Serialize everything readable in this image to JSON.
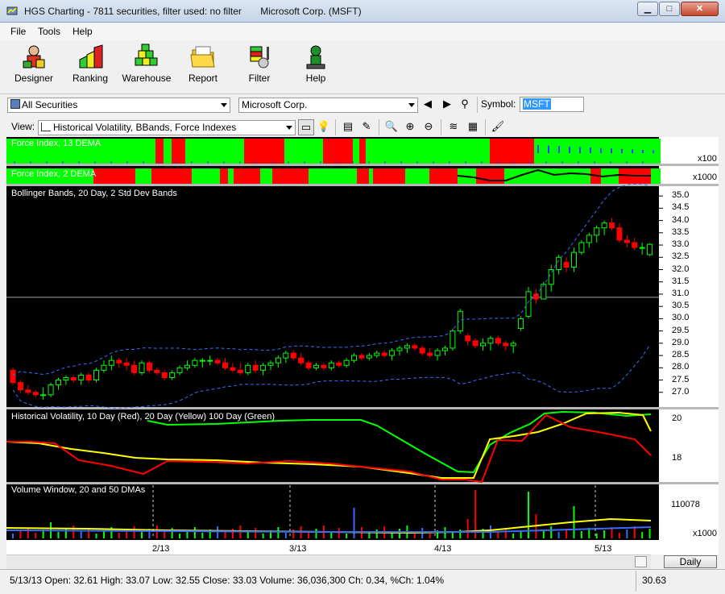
{
  "window": {
    "title": "HGS Charting - 7811 securities, filter used: no filter       Microsoft Corp. (MSFT)",
    "minimize": "▁",
    "maximize": "□",
    "close": "✕"
  },
  "menu": [
    "File",
    "Tools",
    "Help"
  ],
  "toolbar": [
    {
      "label": "Designer",
      "icon": "designer-icon"
    },
    {
      "label": "Ranking",
      "icon": "ranking-icon"
    },
    {
      "label": "Warehouse",
      "icon": "warehouse-icon"
    },
    {
      "label": "Report",
      "icon": "report-icon"
    },
    {
      "label": "Filter",
      "icon": "filter-icon"
    },
    {
      "label": "Help",
      "icon": "help-icon"
    }
  ],
  "securities_list": {
    "value": "All Securities"
  },
  "security": {
    "value": "Microsoft Corp."
  },
  "symbol": {
    "label": "Symbol:",
    "value": "MSFT"
  },
  "view": {
    "label": "View:",
    "value": "Historical Volatility, BBands, Force Indexes"
  },
  "panes": {
    "force13": {
      "label": "Force Index, 13 DEMA",
      "scale": "x100"
    },
    "force2": {
      "label": "Force Index, 2 DEMA",
      "scale": "x1000"
    },
    "bbands": {
      "label": "Bollinger Bands, 20 Day, 2 Std Dev Bands",
      "ticks": [
        "35.0",
        "34.5",
        "34.0",
        "33.5",
        "33.0",
        "32.5",
        "32.0",
        "31.5",
        "31.0",
        "30.5",
        "30.0",
        "29.5",
        "29.0",
        "28.5",
        "28.0",
        "27.5",
        "27.0"
      ]
    },
    "hv": {
      "label": "Historical Volatility, 10 Day (Red), 20 Day (Yellow)  100 Day (Green)",
      "ticks": [
        "20",
        "18"
      ]
    },
    "volume": {
      "label": "Volume Window, 20 and 50 DMAs",
      "ticks": [
        "110078",
        "x1000"
      ]
    }
  },
  "date_labels": [
    "2/13",
    "3/13",
    "4/13",
    "5/13"
  ],
  "period_button": "Daily",
  "status": {
    "text": "5/13/13 Open: 32.61 High: 33.07 Low: 32.55 Close: 33.03 Volume: 36,036,300 Ch: 0.34, %Ch: 1.04%",
    "cursor_value": "30.63"
  },
  "colors": {
    "up": "#00ff00",
    "down": "#ff0000",
    "band": "#3a6bff",
    "yellow": "#ffff00",
    "bg": "#000000"
  },
  "chart_data": [
    {
      "type": "candlestick",
      "title": "Bollinger Bands, 20 Day, 2 Std Dev Bands",
      "ylim": [
        26.5,
        35.3
      ],
      "ohlc": [
        [
          27.9,
          28.0,
          27.3,
          27.4
        ],
        [
          27.4,
          27.5,
          27.0,
          27.1
        ],
        [
          27.1,
          27.3,
          26.9,
          27.0
        ],
        [
          27.0,
          27.1,
          26.8,
          26.9
        ],
        [
          26.9,
          27.2,
          26.7,
          26.9
        ],
        [
          26.9,
          27.4,
          26.8,
          27.3
        ],
        [
          27.3,
          27.6,
          27.1,
          27.5
        ],
        [
          27.5,
          27.7,
          27.3,
          27.6
        ],
        [
          27.6,
          27.7,
          27.4,
          27.5
        ],
        [
          27.5,
          27.8,
          27.3,
          27.7
        ],
        [
          27.7,
          27.8,
          27.4,
          27.5
        ],
        [
          27.5,
          28.0,
          27.4,
          27.9
        ],
        [
          27.9,
          28.3,
          27.8,
          28.1
        ],
        [
          28.1,
          28.5,
          27.9,
          28.3
        ],
        [
          28.3,
          28.4,
          28.0,
          28.2
        ],
        [
          28.2,
          28.4,
          27.9,
          28.1
        ],
        [
          28.1,
          28.3,
          27.7,
          27.8
        ],
        [
          27.8,
          28.3,
          27.7,
          28.2
        ],
        [
          28.2,
          28.3,
          27.8,
          27.9
        ],
        [
          27.9,
          28.0,
          27.7,
          27.8
        ],
        [
          27.8,
          27.9,
          27.5,
          27.6
        ],
        [
          27.6,
          27.9,
          27.5,
          27.8
        ],
        [
          27.8,
          28.1,
          27.7,
          28.0
        ],
        [
          28.0,
          28.3,
          27.9,
          28.1
        ],
        [
          28.1,
          28.4,
          28.0,
          28.3
        ],
        [
          28.3,
          28.4,
          28.0,
          28.3
        ],
        [
          28.3,
          28.5,
          28.1,
          28.3
        ],
        [
          28.3,
          28.4,
          28.1,
          28.2
        ],
        [
          28.2,
          28.4,
          27.9,
          28.0
        ],
        [
          28.0,
          28.2,
          27.8,
          27.9
        ],
        [
          27.9,
          28.2,
          27.7,
          27.8
        ],
        [
          27.8,
          28.2,
          27.7,
          28.1
        ],
        [
          28.1,
          28.3,
          27.8,
          27.9
        ],
        [
          27.9,
          28.2,
          27.7,
          28.1
        ],
        [
          28.1,
          28.3,
          27.9,
          28.2
        ],
        [
          28.2,
          28.5,
          28.0,
          28.4
        ],
        [
          28.4,
          28.7,
          28.2,
          28.6
        ],
        [
          28.6,
          28.7,
          28.3,
          28.4
        ],
        [
          28.4,
          28.6,
          28.1,
          28.2
        ],
        [
          28.2,
          28.3,
          27.9,
          28.0
        ],
        [
          28.0,
          28.2,
          27.9,
          28.1
        ],
        [
          28.1,
          28.2,
          27.9,
          28.0
        ],
        [
          28.0,
          28.3,
          27.9,
          28.2
        ],
        [
          28.2,
          28.3,
          28.0,
          28.1
        ],
        [
          28.1,
          28.4,
          28.0,
          28.3
        ],
        [
          28.3,
          28.6,
          28.2,
          28.5
        ],
        [
          28.5,
          28.6,
          28.3,
          28.4
        ],
        [
          28.4,
          28.6,
          28.3,
          28.5
        ],
        [
          28.5,
          28.7,
          28.4,
          28.6
        ],
        [
          28.6,
          28.7,
          28.4,
          28.5
        ],
        [
          28.5,
          28.8,
          28.3,
          28.7
        ],
        [
          28.7,
          28.9,
          28.5,
          28.8
        ],
        [
          28.8,
          29.0,
          28.6,
          28.9
        ],
        [
          28.9,
          29.0,
          28.7,
          28.8
        ],
        [
          28.8,
          28.9,
          28.5,
          28.6
        ],
        [
          28.6,
          28.8,
          28.4,
          28.5
        ],
        [
          28.5,
          28.8,
          28.3,
          28.7
        ],
        [
          28.7,
          28.9,
          28.5,
          28.8
        ],
        [
          28.8,
          29.6,
          28.7,
          29.5
        ],
        [
          29.5,
          30.4,
          29.4,
          30.3
        ],
        [
          29.3,
          29.4,
          28.9,
          29.1
        ],
        [
          29.1,
          29.2,
          28.8,
          28.9
        ],
        [
          28.9,
          29.2,
          28.7,
          29.0
        ],
        [
          29.0,
          29.3,
          28.7,
          29.2
        ],
        [
          29.2,
          29.3,
          28.9,
          29.0
        ],
        [
          29.0,
          29.1,
          28.7,
          28.9
        ],
        [
          28.9,
          29.1,
          28.6,
          29.0
        ],
        [
          29.6,
          30.1,
          29.5,
          30.0
        ],
        [
          30.1,
          31.3,
          30.0,
          31.1
        ],
        [
          31.0,
          31.2,
          30.6,
          30.8
        ],
        [
          30.8,
          31.5,
          30.8,
          31.4
        ],
        [
          31.4,
          32.2,
          31.1,
          32.0
        ],
        [
          32.0,
          32.6,
          31.8,
          32.5
        ],
        [
          32.3,
          32.5,
          31.9,
          32.1
        ],
        [
          32.1,
          32.9,
          31.9,
          32.7
        ],
        [
          32.7,
          33.2,
          32.6,
          33.1
        ],
        [
          33.1,
          33.5,
          32.9,
          33.4
        ],
        [
          33.4,
          33.8,
          33.1,
          33.7
        ],
        [
          33.7,
          34.0,
          33.4,
          33.9
        ],
        [
          33.9,
          34.1,
          33.6,
          33.7
        ],
        [
          33.7,
          33.9,
          33.1,
          33.2
        ],
        [
          33.2,
          33.4,
          32.9,
          33.1
        ],
        [
          33.1,
          33.3,
          32.8,
          32.9
        ],
        [
          32.9,
          33.1,
          32.6,
          32.9
        ],
        [
          32.61,
          33.07,
          32.55,
          33.03
        ]
      ]
    },
    {
      "type": "line",
      "title": "Historical Volatility, 10 Day (Red), 20 Day (Yellow)  100 Day (Green)",
      "series": [
        {
          "name": "10 Day",
          "color": "#ff0000"
        },
        {
          "name": "20 Day",
          "color": "#ffff00"
        },
        {
          "name": "100 Day",
          "color": "#00ff00"
        }
      ]
    },
    {
      "type": "bar",
      "title": "Volume Window, 20 and 50 DMAs",
      "ytick": "110078",
      "yunit": "x1000"
    }
  ]
}
